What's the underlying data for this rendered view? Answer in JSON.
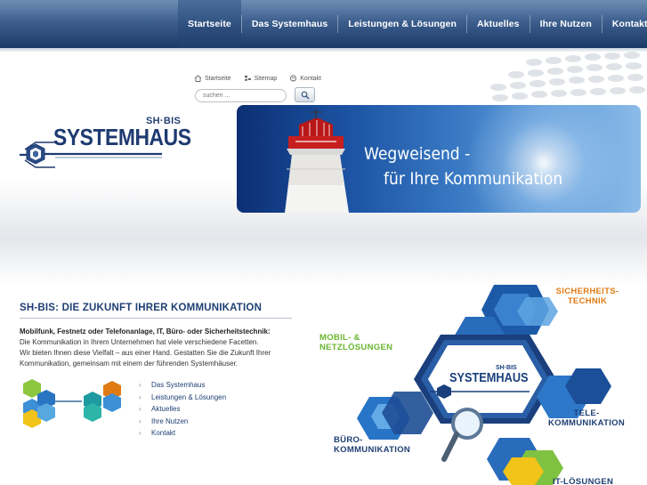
{
  "nav": {
    "items": [
      {
        "label": "Startseite",
        "active": true
      },
      {
        "label": "Das Systemhaus",
        "active": false
      },
      {
        "label": "Leistungen & Lösungen",
        "active": false
      },
      {
        "label": "Aktuelles",
        "active": false
      },
      {
        "label": "Ihre Nutzen",
        "active": false
      },
      {
        "label": "Kontakt",
        "active": false
      }
    ]
  },
  "utility": {
    "home_label": "Startseite",
    "sitemap_label": "Sitemap",
    "contact_label": "Kontakt",
    "search_placeholder": "suchen ..."
  },
  "logo": {
    "sh": "SH·BIS",
    "title": "SYSTEMHAUS"
  },
  "banner": {
    "line1": "Wegweisend -",
    "line2": "für Ihre Kommunikation"
  },
  "intro": {
    "heading": "SH-BIS: DIE ZUKUNFT IHRER KOMMUNIKATION",
    "bold": "Mobilfunk, Festnetz oder Telefonanlage, IT, Büro- oder Sicherheitstechnik:",
    "line1": "Die Kommunikation in Ihrem Unternehmen hat viele verschiedene Facetten.",
    "line2": "Wir bieten Ihnen diese Vielfalt – aus einer Hand. Gestatten Sie die Zukunft Ihrer",
    "line3": "Kommunikation, gemeinsam mit einem der führenden Systemhäuser."
  },
  "quick_links": [
    {
      "label": "Das Systemhaus"
    },
    {
      "label": "Leistungen & Lösungen"
    },
    {
      "label": "Aktuelles"
    },
    {
      "label": "Ihre Nutzen"
    },
    {
      "label": "Kontakt"
    }
  ],
  "graphic": {
    "center_sh": "SH·BIS",
    "center_title": "SYSTEMHAUS",
    "label_security_1": "SICHERHEITS-",
    "label_security_2": "TECHNIK",
    "label_mobile_1": "MOBIL- &",
    "label_mobile_2": "NETZLÖSUNGEN",
    "label_tele_1": "TELE-",
    "label_tele_2": "KOMMUNIKATION",
    "label_buero_1": "BÜRO-",
    "label_buero_2": "KOMMUNIKATION",
    "label_it": "IT-LÖSUNGEN"
  },
  "colors": {
    "nav_dark": "#1b3a66",
    "brand_blue": "#1f3f73",
    "orange": "#e07b14",
    "green": "#69b52d",
    "light_blue": "#3d8fd6"
  }
}
